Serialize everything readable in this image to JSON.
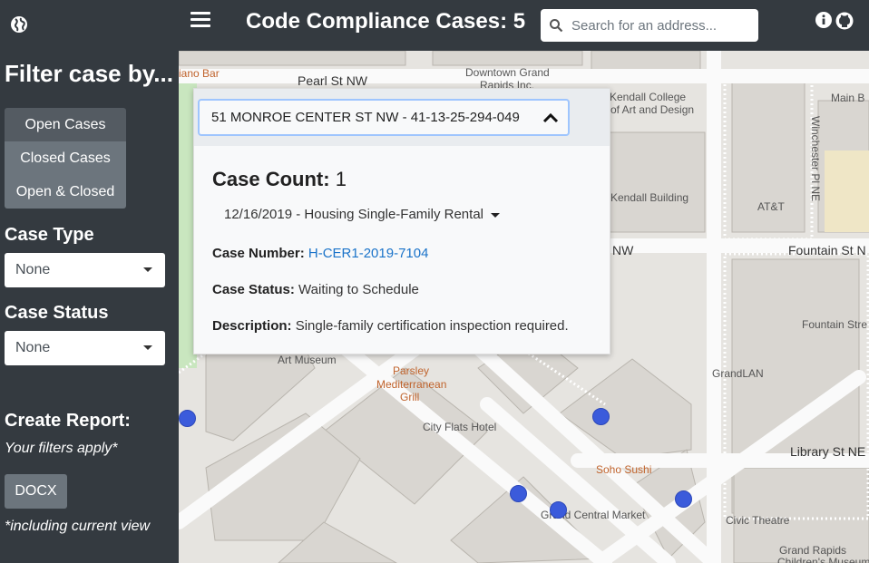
{
  "header": {
    "title": "Code Compliance Cases: 5",
    "search_placeholder": "Search for an address..."
  },
  "sidebar": {
    "title": "Filter case by...",
    "filter_buttons": [
      "Open Cases",
      "Closed Cases",
      "Open & Closed"
    ],
    "case_type_label": "Case Type",
    "case_type_value": "None",
    "case_status_label": "Case Status",
    "case_status_value": "None",
    "report_label": "Create Report:",
    "report_note": "Your filters apply*",
    "docx_label": "DOCX",
    "footnote": "*including current view"
  },
  "popup": {
    "address": "51 MONROE CENTER ST NW - 41-13-25-294-049",
    "case_count_label": "Case Count:",
    "case_count_value": "1",
    "case_select": "12/16/2019 - Housing Single-Family Rental",
    "case_number_label": "Case Number:",
    "case_number_value": "H-CER1-2019-7104",
    "case_status_label": "Case Status:",
    "case_status_value": "Waiting to Schedule",
    "description_label": "Description:",
    "description_value": "Single-family certification inspection required."
  },
  "map_labels": {
    "pearl": "Pearl St NW",
    "downtown": "Downtown Grand",
    "downtown2": "Rapids Inc.",
    "kendall1": "Kendall College",
    "kendall2": "of Art and Design",
    "kendall_building": "Kendall Building",
    "mainb": "Main B",
    "winchester": "Winchester Pl NE",
    "att": "AT&T",
    "nw": "NW",
    "fountain": "Fountain St N",
    "fountain_st": "Fountain Stre",
    "grandlan": "GrandLAN",
    "art_museum": "Art Museum",
    "parsley1": "Parsley",
    "parsley2": "Mediterranean",
    "parsley3": "Grill",
    "city_flats": "City Flats Hotel",
    "library": "Library St NE",
    "soho": "Soho Sushi",
    "gcm": "Grand Central Market",
    "civic": "Civic Theatre",
    "gr1": "Grand Rapids",
    "gr2": "Children's Museum",
    "piano": "iano Bar"
  }
}
